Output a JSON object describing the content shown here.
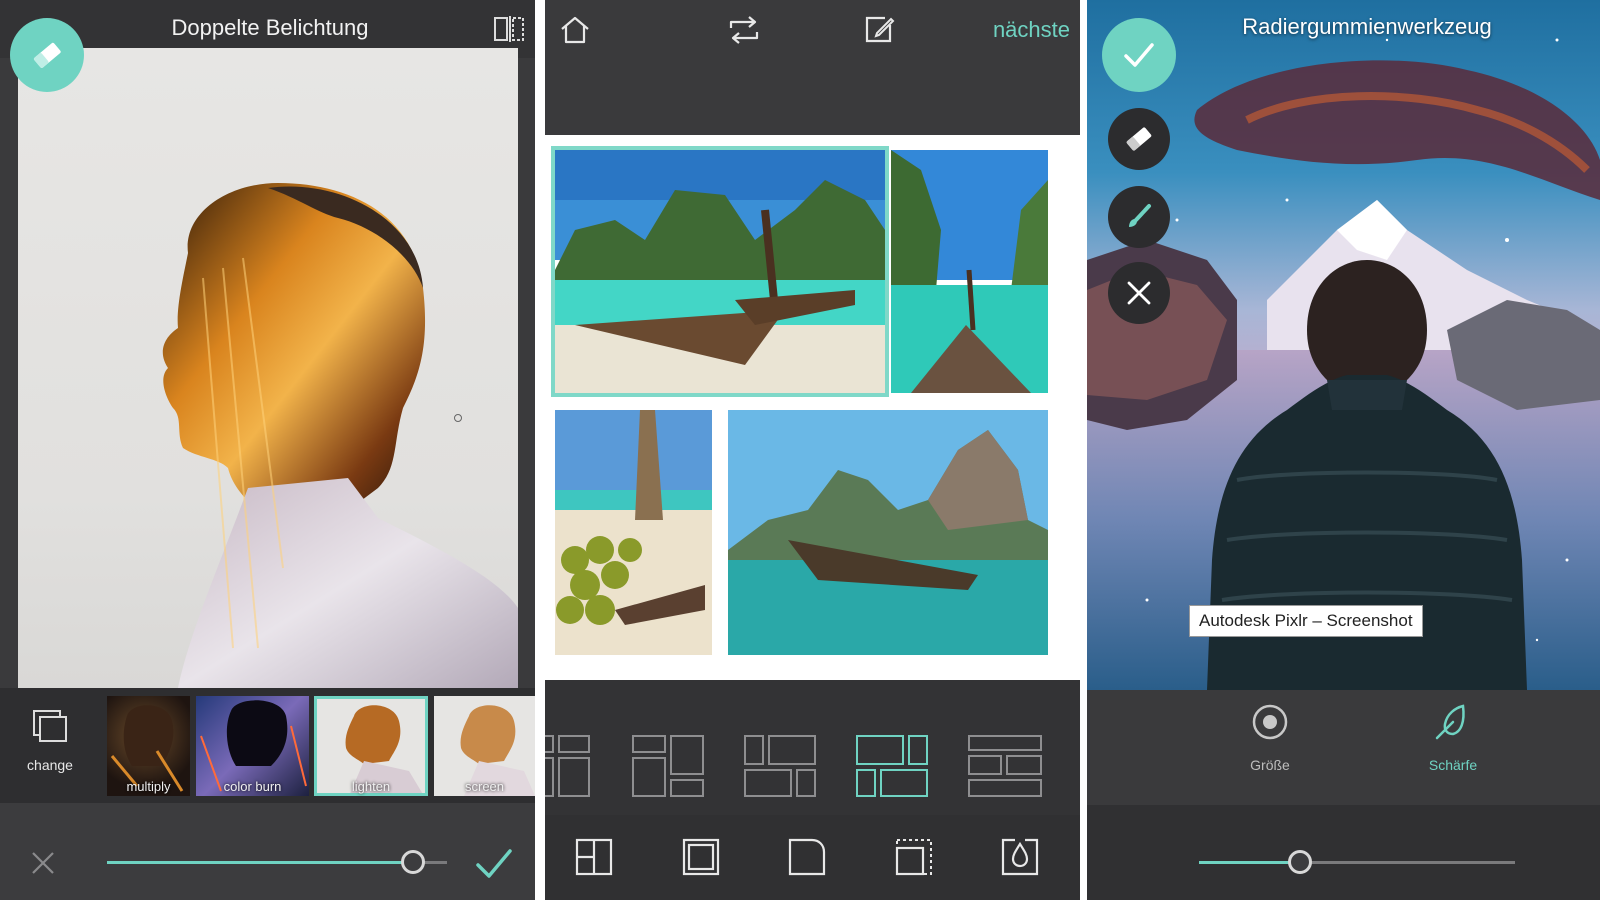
{
  "double_exposure": {
    "title": "Doppelte Belichtung",
    "change_label": "change",
    "blend_modes": [
      {
        "label": "multiply"
      },
      {
        "label": "color burn"
      },
      {
        "label": "lighten",
        "selected": true
      },
      {
        "label": "screen"
      }
    ],
    "opacity": 0.9
  },
  "collage": {
    "next_label": "nächste"
  },
  "eraser": {
    "title": "Radiergummienwerkzeug",
    "credit": "Autodesk Pixlr – Screenshot",
    "tools": [
      {
        "label": "Größe"
      },
      {
        "label": "Schärfe",
        "active": true
      }
    ],
    "brush_level": 0.32
  },
  "colors": {
    "accent": "#6fd3c2",
    "panel_bg": "#3a3a3c"
  },
  "icons": {
    "eraser": "eraser-icon",
    "compare": "compare-icon",
    "change": "layers-icon",
    "close": "close-icon",
    "confirm": "check-icon",
    "home": "home-icon",
    "swap": "swap-icon",
    "edit": "edit-icon",
    "brush": "brush-icon",
    "size": "size-icon",
    "sharpness": "feather-icon"
  }
}
